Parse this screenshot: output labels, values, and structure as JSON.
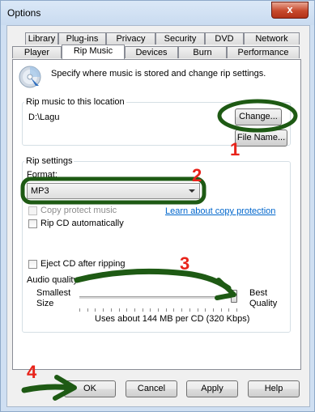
{
  "window": {
    "title": "Options",
    "close_label": "x"
  },
  "tabs_row1": [
    "Library",
    "Plug-ins",
    "Privacy",
    "Security",
    "DVD",
    "Network"
  ],
  "tabs_row2": [
    "Player",
    "Rip Music",
    "Devices",
    "Burn",
    "Performance"
  ],
  "active_tab": "Rip Music",
  "intro": {
    "text": "Specify where music is stored and change rip settings."
  },
  "location": {
    "group_label": "Rip music to this location",
    "path": "D:\\Lagu",
    "change_button": "Change...",
    "file_name_button": "File Name..."
  },
  "rip_settings": {
    "group_label": "Rip settings",
    "format_label": "Format:",
    "format_value": "MP3",
    "copy_protect_label": "Copy protect music",
    "copy_protect_link": "Learn about copy protection",
    "rip_auto_label": "Rip CD automatically",
    "eject_label": "Eject CD after ripping",
    "audio_quality_label": "Audio quality:",
    "smallest_size_label": "Smallest\nSize",
    "best_quality_label": "Best\nQuality",
    "usage_text": "Uses about 144 MB per CD (320 Kbps)",
    "quality_level_fraction": 1.0
  },
  "buttons": {
    "ok": "OK",
    "cancel": "Cancel",
    "apply": "Apply",
    "help": "Help"
  },
  "annotations": {
    "step1": "1",
    "step2": "2",
    "step3": "3",
    "step4": "4"
  },
  "colors": {
    "annotation_red": "#e8231a",
    "annotation_green": "#1e5a14",
    "link_blue": "#0066cc"
  }
}
